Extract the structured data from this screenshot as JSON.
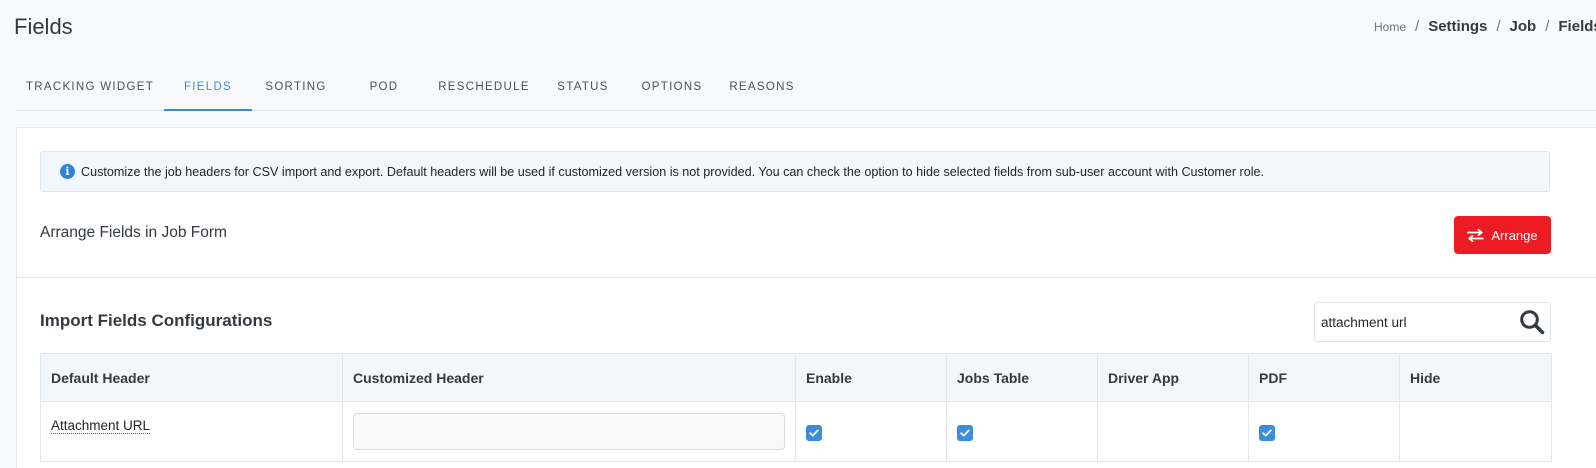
{
  "page": {
    "title": "Fields"
  },
  "breadcrumb": {
    "home": "Home",
    "settings": "Settings",
    "job": "Job",
    "current": "Fields"
  },
  "tabs": [
    {
      "label": "TRACKING WIDGET",
      "active": false
    },
    {
      "label": "FIELDS",
      "active": true
    },
    {
      "label": "SORTING",
      "active": false
    },
    {
      "label": "POD",
      "active": false
    },
    {
      "label": "RESCHEDULE",
      "active": false
    },
    {
      "label": "STATUS",
      "active": false
    },
    {
      "label": "OPTIONS",
      "active": false
    },
    {
      "label": "REASONS",
      "active": false
    }
  ],
  "info": {
    "text": "Customize the job headers for CSV import and export. Default headers will be used if customized version is not provided. You can check the option to hide selected fields from sub-user account with Customer role."
  },
  "arrange": {
    "title": "Arrange Fields in Job Form",
    "button_label": "Arrange"
  },
  "import": {
    "title": "Import Fields Configurations",
    "search_value": "attachment url"
  },
  "table": {
    "headers": [
      "Default Header",
      "Customized Header",
      "Enable",
      "Jobs Table",
      "Driver App",
      "PDF",
      "Hide"
    ],
    "rows": [
      {
        "default_header": "Attachment URL",
        "customized_header": "",
        "enable": true,
        "jobs_table": true,
        "driver_app": false,
        "pdf": true,
        "hide": false
      }
    ]
  },
  "colors": {
    "accent": "#3b8ede",
    "danger": "#ed1c24",
    "info_bg": "#f2f7fd"
  },
  "icons": {
    "info": "info-icon",
    "arrange": "swap-arrows-icon",
    "search": "search-icon",
    "check": "check-icon"
  }
}
